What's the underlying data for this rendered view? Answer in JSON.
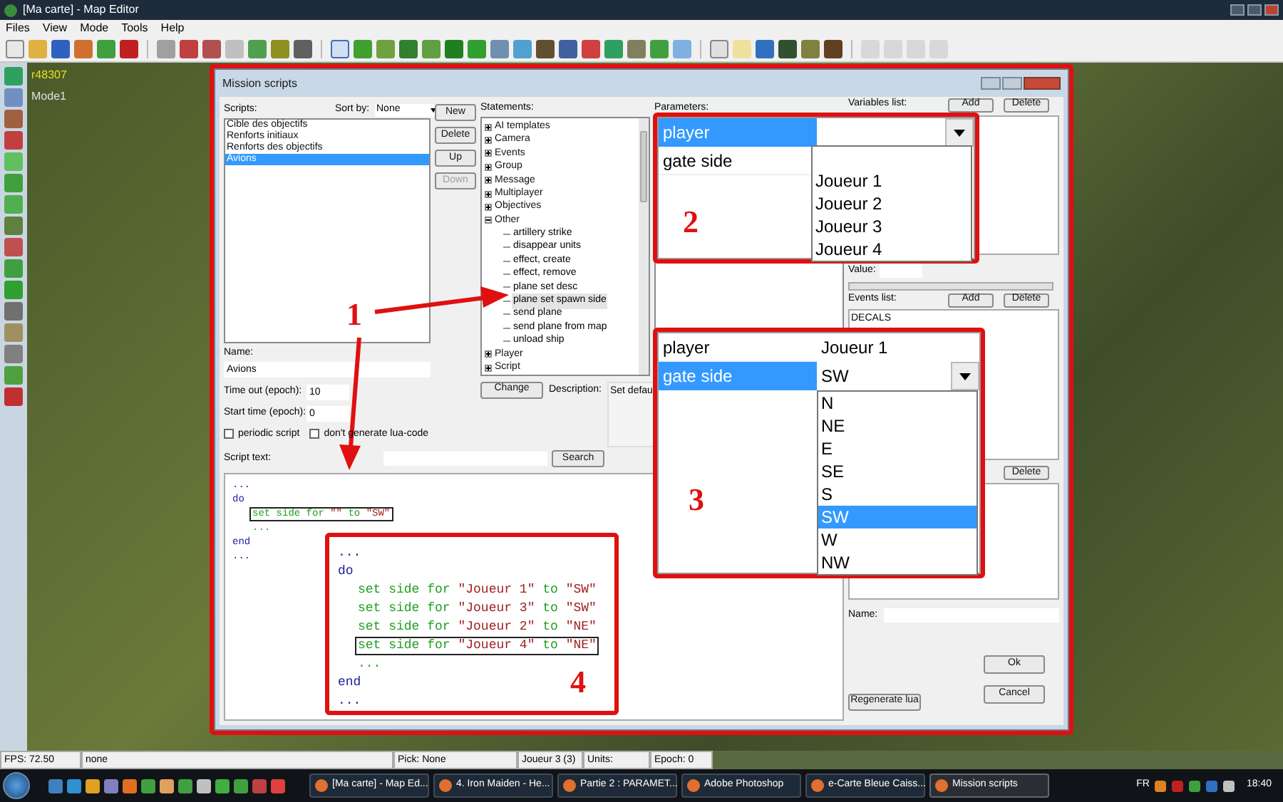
{
  "window": {
    "title": "[Ma carte] - Map Editor"
  },
  "menu": [
    "Files",
    "View",
    "Mode",
    "Tools",
    "Help"
  ],
  "overlay": {
    "build": "r48307",
    "mode": "Mode1"
  },
  "dialog": {
    "title": "Mission scripts",
    "scripts_label": "Scripts:",
    "sort_label": "Sort by:",
    "sort_value": "None",
    "scripts": [
      {
        "label": "Cible des objectifs",
        "selected": false
      },
      {
        "label": "Renforts initiaux",
        "selected": false
      },
      {
        "label": "Renforts des objectifs",
        "selected": false
      },
      {
        "label": "Avions",
        "selected": true
      }
    ],
    "script_buttons": [
      {
        "label": "New",
        "disabled": false
      },
      {
        "label": "Delete",
        "disabled": false
      },
      {
        "label": "Up",
        "disabled": false
      },
      {
        "label": "Down",
        "disabled": true
      }
    ],
    "name_label": "Name:",
    "name_value": "Avions",
    "timeout_label": "Time out (epoch):",
    "timeout_value": "10",
    "start_label": "Start time (epoch):",
    "start_value": "0",
    "checkboxes": [
      {
        "label": "periodic script",
        "checked": false
      },
      {
        "label": "don't generate lua-code",
        "checked": false
      }
    ],
    "script_text_label": "Script text:",
    "search_button": "Search",
    "code": [
      {
        "tokens": [
          {
            "kind": "keyword",
            "text": "..."
          }
        ],
        "indented": false,
        "boxed": false
      },
      {
        "tokens": [
          {
            "kind": "keyword",
            "text": "do"
          }
        ],
        "indented": false,
        "boxed": false
      },
      {
        "tokens": [
          {
            "kind": "command",
            "text": "set side for "
          },
          {
            "kind": "string",
            "text": "\"\""
          },
          {
            "kind": "command",
            "text": " to "
          },
          {
            "kind": "string",
            "text": "\"SW\""
          }
        ],
        "indented": true,
        "boxed": true
      },
      {
        "tokens": [
          {
            "kind": "command",
            "text": "..."
          }
        ],
        "indented": true,
        "boxed": false
      },
      {
        "tokens": [
          {
            "kind": "keyword",
            "text": "end"
          }
        ],
        "indented": false,
        "boxed": false
      },
      {
        "tokens": [
          {
            "kind": "keyword",
            "text": "..."
          }
        ],
        "indented": false,
        "boxed": false
      }
    ],
    "statements_label": "Statements:",
    "statements": [
      {
        "label": "AI templates",
        "expanded": false
      },
      {
        "label": "Camera",
        "expanded": false
      },
      {
        "label": "Events",
        "expanded": false
      },
      {
        "label": "Group",
        "expanded": false
      },
      {
        "label": "Message",
        "expanded": false
      },
      {
        "label": "Multiplayer",
        "expanded": false
      },
      {
        "label": "Objectives",
        "expanded": false
      },
      {
        "label": "Other",
        "expanded": true,
        "children": [
          {
            "label": "artillery strike",
            "selected": false
          },
          {
            "label": "disappear units",
            "selected": false
          },
          {
            "label": "effect, create",
            "selected": false
          },
          {
            "label": "effect, remove",
            "selected": false
          },
          {
            "label": "plane set desc",
            "selected": false
          },
          {
            "label": "plane set spawn side",
            "selected": true
          },
          {
            "label": "send plane",
            "selected": false
          },
          {
            "label": "send plane from map",
            "selected": false
          },
          {
            "label": "unload ship",
            "selected": false
          }
        ]
      },
      {
        "label": "Player",
        "expanded": false
      },
      {
        "label": "Script",
        "expanded": false
      }
    ],
    "change_button": "Change",
    "description_label": "Description:",
    "description": "Set defau",
    "parameters_label": "Parameters:",
    "variables_label": "Variables list:",
    "variables_buttons": [
      "Add",
      "Delete"
    ],
    "value_label": "Value:",
    "events_label": "Events list:",
    "events_buttons": [
      "Add",
      "Delete"
    ],
    "events": [
      "DECALS"
    ],
    "third_list_buttons": [
      "Delete"
    ],
    "name2_label": "Name:",
    "ok_button": "Ok",
    "cancel_button": "Cancel",
    "regenerate_button": "Regenerate lua"
  },
  "annotation_1": {
    "number": "1"
  },
  "annotation_2": {
    "number": "2",
    "rows": [
      {
        "name": "player",
        "value": "",
        "selected": true,
        "dropdown": true
      },
      {
        "name": "gate side",
        "selected": false,
        "dropdown": false
      }
    ],
    "options": [
      {
        "label": "Joueur 1",
        "selected": false
      },
      {
        "label": "Joueur 2",
        "selected": false
      },
      {
        "label": "Joueur 3",
        "selected": false
      },
      {
        "label": "Joueur 4",
        "selected": false
      }
    ]
  },
  "annotation_3": {
    "number": "3",
    "rows": [
      {
        "name": "player",
        "value": "Joueur 1",
        "selected": false,
        "dropdown": false
      },
      {
        "name": "gate side",
        "value": "SW",
        "selected": true,
        "dropdown": true
      }
    ],
    "options": [
      {
        "label": "N",
        "selected": false
      },
      {
        "label": "NE",
        "selected": false
      },
      {
        "label": "E",
        "selected": false
      },
      {
        "label": "SE",
        "selected": false
      },
      {
        "label": "S",
        "selected": false
      },
      {
        "label": "SW",
        "selected": true
      },
      {
        "label": "W",
        "selected": false
      },
      {
        "label": "NW",
        "selected": false
      }
    ]
  },
  "annotation_4": {
    "number": "4",
    "code": [
      {
        "tokens": [
          {
            "kind": "keyword",
            "text": "..."
          }
        ],
        "indented": false,
        "boxed": false
      },
      {
        "tokens": [
          {
            "kind": "keyword",
            "text": "do"
          }
        ],
        "indented": false,
        "boxed": false
      },
      {
        "tokens": [
          {
            "kind": "command",
            "text": "set side for "
          },
          {
            "kind": "string",
            "text": "\"Joueur 1\""
          },
          {
            "kind": "command",
            "text": " to "
          },
          {
            "kind": "string",
            "text": "\"SW\""
          }
        ],
        "indented": true,
        "boxed": false
      },
      {
        "tokens": [
          {
            "kind": "command",
            "text": "set side for "
          },
          {
            "kind": "string",
            "text": "\"Joueur 3\""
          },
          {
            "kind": "command",
            "text": " to "
          },
          {
            "kind": "string",
            "text": "\"SW\""
          }
        ],
        "indented": true,
        "boxed": false
      },
      {
        "tokens": [
          {
            "kind": "command",
            "text": "set side for "
          },
          {
            "kind": "string",
            "text": "\"Joueur 2\""
          },
          {
            "kind": "command",
            "text": " to "
          },
          {
            "kind": "string",
            "text": "\"NE\""
          }
        ],
        "indented": true,
        "boxed": false
      },
      {
        "tokens": [
          {
            "kind": "command",
            "text": "set side for "
          },
          {
            "kind": "string",
            "text": "\"Joueur 4\""
          },
          {
            "kind": "command",
            "text": " to "
          },
          {
            "kind": "string",
            "text": "\"NE\""
          }
        ],
        "indented": true,
        "boxed": true
      },
      {
        "tokens": [
          {
            "kind": "command",
            "text": "..."
          }
        ],
        "indented": true,
        "boxed": false
      },
      {
        "tokens": [
          {
            "kind": "keyword",
            "text": "end"
          }
        ],
        "indented": false,
        "boxed": false
      },
      {
        "tokens": [
          {
            "kind": "keyword",
            "text": "..."
          }
        ],
        "indented": false,
        "boxed": false
      }
    ]
  },
  "status_bar": [
    "FPS: 72.50",
    "none",
    "Pick: None",
    "Joueur 3 (3)",
    "Units:",
    "Epoch: 0"
  ],
  "taskbar": {
    "tasks": [
      {
        "label": "[Ma carte] - Map Ed...",
        "active": false
      },
      {
        "label": "4. Iron Maiden - He...",
        "active": false
      },
      {
        "label": "Partie 2 : PARAMET...",
        "active": false
      },
      {
        "label": "Adobe Photoshop",
        "active": false
      },
      {
        "label": "e-Carte Bleue Caiss...",
        "active": false
      },
      {
        "label": "Mission scripts",
        "active": true
      }
    ],
    "language": "FR",
    "time": "18:40"
  }
}
